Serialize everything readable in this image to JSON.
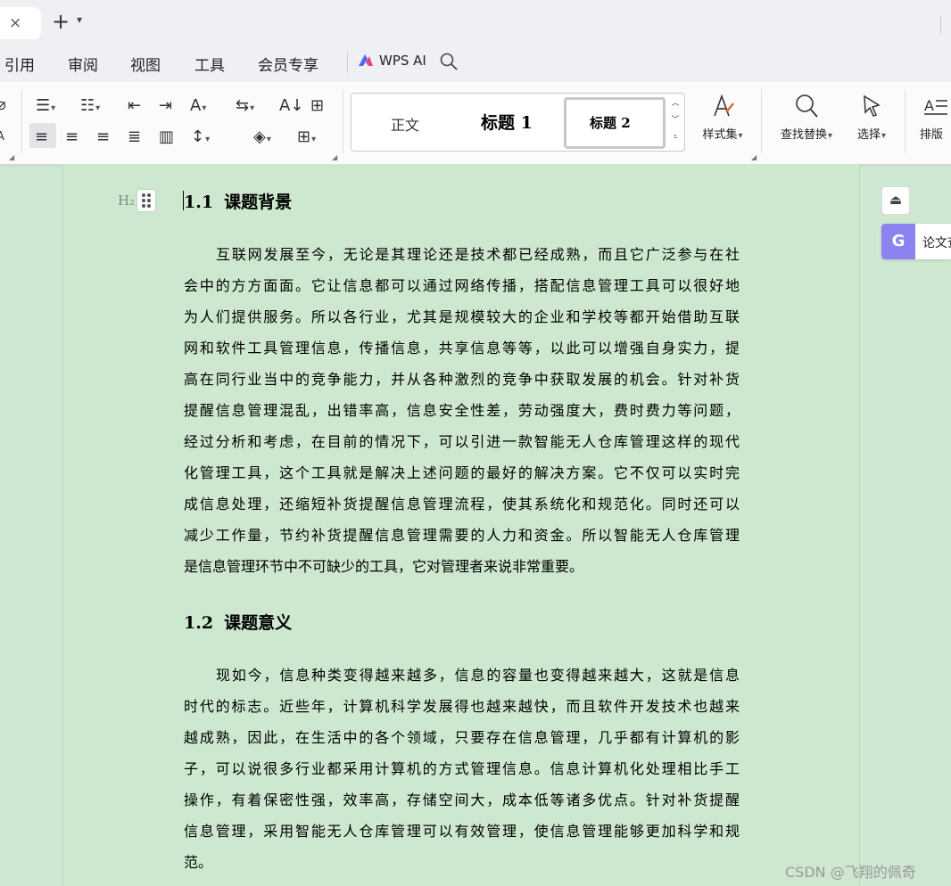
{
  "tabbar": {
    "close_glyph": "×",
    "new_tab_glyph": "+",
    "new_tab_caret": "⌄"
  },
  "menu": {
    "items": [
      "引用",
      "审阅",
      "视图",
      "工具",
      "会员专享"
    ],
    "ai_label": "WPS AI"
  },
  "ribbon": {
    "styles": {
      "normal": "正文",
      "h1": "标题 1",
      "h2": "标题 2"
    },
    "style_set_label": "样式集",
    "find_replace_label": "查找替换",
    "select_label": "选择",
    "layout_label": "排版"
  },
  "document": {
    "heading_marker": "H₂",
    "sections": [
      {
        "number": "1.1",
        "title": "课题背景",
        "lines": [
          "互联网发展至今，无论是其理论还是技术都已经成熟，而且它广泛参与在社",
          "会中的方方面面。它让信息都可以通过网络传播，搭配信息管理工具可以很好地",
          "为人们提供服务。所以各行业，尤其是规模较大的企业和学校等都开始借助互联",
          "网和软件工具管理信息，传播信息，共享信息等等，以此可以增强自身实力，提",
          "高在同行业当中的竞争能力，并从各种激烈的竞争中获取发展的机会。针对补货",
          "提醒信息管理混乱，出错率高，信息安全性差，劳动强度大，费时费力等问题，",
          "经过分析和考虑，在目前的情况下，可以引进一款智能无人仓库管理这样的现代",
          "化管理工具，这个工具就是解决上述问题的最好的解决方案。它不仅可以实时完",
          "成信息处理，还缩短补货提醒信息管理流程，使其系统化和规范化。同时还可以",
          "减少工作量，节约补货提醒信息管理需要的人力和资金。所以智能无人仓库管理",
          "是信息管理环节中不可缺少的工具，它对管理者来说非常重要。"
        ]
      },
      {
        "number": "1.2",
        "title": "课题意义",
        "lines": [
          "现如今，信息种类变得越来越多，信息的容量也变得越来越大，这就是信息",
          "时代的标志。近些年，计算机科学发展得也越来越快，而且软件开发技术也越来",
          "越成熟，因此，在生活中的各个领域，只要存在信息管理，几乎都有计算机的影",
          "子，可以说很多行业都采用计算机的方式管理信息。信息计算机化处理相比手工",
          "操作，有着保密性强，效率高，存储空间大，成本低等诸多优点。针对补货提醒",
          "信息管理，采用智能无人仓库管理可以有效管理，使信息管理能够更加科学和规",
          "范。"
        ]
      }
    ]
  },
  "side": {
    "panel_label": "论文查"
  },
  "watermark": "CSDN @飞翔的佩奇",
  "colors": {
    "page_background": "#cde8cf",
    "ai_accent": "#8b83f0"
  }
}
